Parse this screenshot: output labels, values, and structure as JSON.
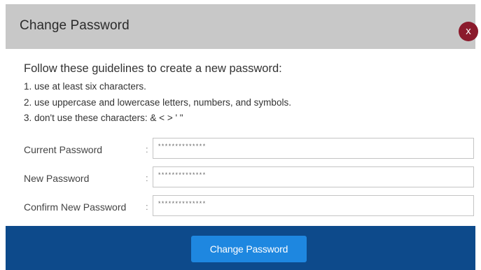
{
  "dialog": {
    "title": "Change Password",
    "close_label": "x"
  },
  "guidelines": {
    "heading": "Follow these guidelines to create a new password:",
    "items": [
      "1. use at least six characters.",
      "2. use uppercase and lowercase letters, numbers, and symbols.",
      "3. don't use these characters: & < > ' \""
    ]
  },
  "fields": [
    {
      "label": "Current Password",
      "colon": ":",
      "value": "**************"
    },
    {
      "label": "New Password",
      "colon": ":",
      "value": "**************"
    },
    {
      "label": "Confirm New Password",
      "colon": ":",
      "value": "**************"
    }
  ],
  "footer": {
    "submit_label": "Change Password"
  },
  "colors": {
    "header_bg": "#c8c8c8",
    "close_bg": "#8b1a2c",
    "footer_bg": "#0d4a8b",
    "button_bg": "#1e87e0"
  }
}
